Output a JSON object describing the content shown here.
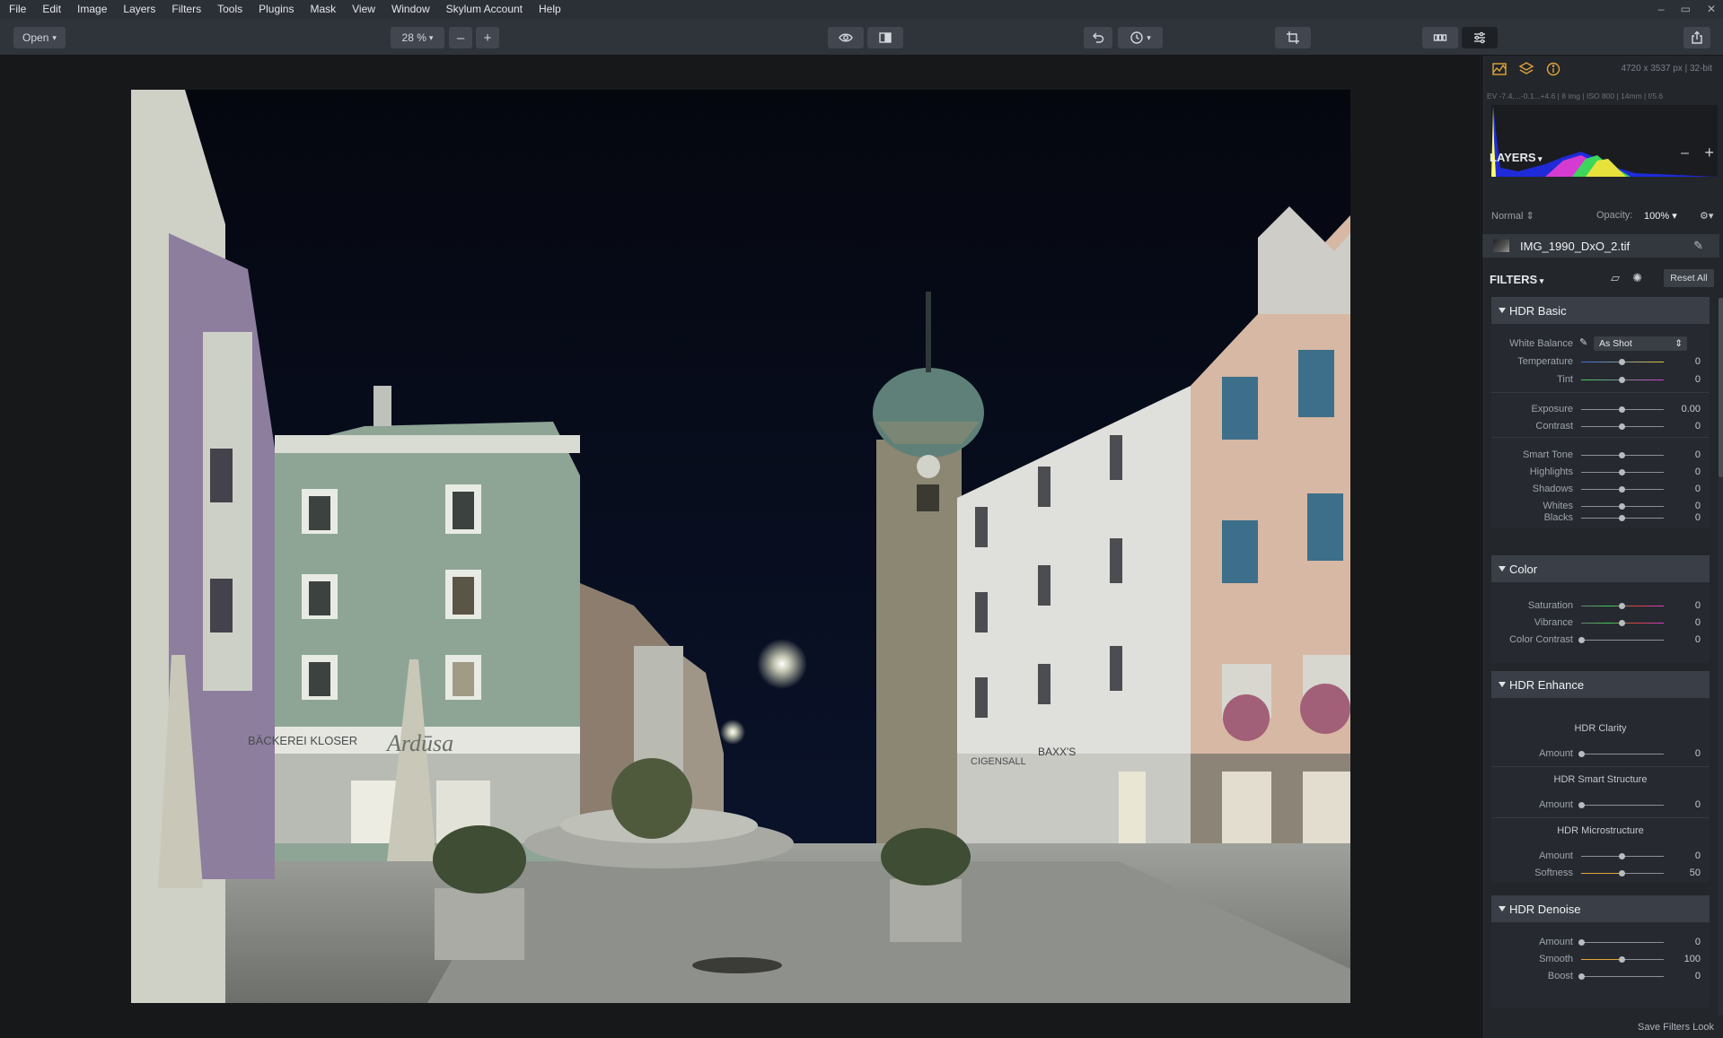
{
  "menu": [
    "File",
    "Edit",
    "Image",
    "Layers",
    "Filters",
    "Tools",
    "Plugins",
    "Mask",
    "View",
    "Window",
    "Skylum Account",
    "Help"
  ],
  "window_controls": [
    "–",
    "▭",
    "✕"
  ],
  "toolbar": {
    "open_label": "Open",
    "zoom_label": "28 %",
    "zoom_out": "–",
    "zoom_in": "+"
  },
  "panel": {
    "image_info": "4720 x 3537 px  |  32-bit",
    "exif": "EV -7.4,...-0.1...+4.6  |  8 img  |  ISO 800  |  14mm  |  f/5.6",
    "layers_title": "LAYERS",
    "blend_mode": "Normal",
    "opacity_label": "Opacity:",
    "opacity_value": "100%",
    "layer_name": "IMG_1990_DxO_2.tif",
    "filters_title": "FILTERS",
    "reset_all": "Reset All",
    "save_look": "Save Filters Look"
  },
  "filters": {
    "hdr_basic": {
      "title": "HDR Basic",
      "wb_label": "White Balance",
      "wb_value": "As Shot",
      "temperature": {
        "label": "Temperature",
        "value": "0"
      },
      "tint": {
        "label": "Tint",
        "value": "0"
      },
      "exposure": {
        "label": "Exposure",
        "value": "0.00"
      },
      "contrast": {
        "label": "Contrast",
        "value": "0"
      },
      "smart_tone": {
        "label": "Smart Tone",
        "value": "0"
      },
      "highlights": {
        "label": "Highlights",
        "value": "0"
      },
      "shadows": {
        "label": "Shadows",
        "value": "0"
      },
      "whites": {
        "label": "Whites",
        "value": "0"
      },
      "blacks": {
        "label": "Blacks",
        "value": "0"
      }
    },
    "color": {
      "title": "Color",
      "saturation": {
        "label": "Saturation",
        "value": "0"
      },
      "vibrance": {
        "label": "Vibrance",
        "value": "0"
      },
      "color_contrast": {
        "label": "Color Contrast",
        "value": "0"
      }
    },
    "hdr_enhance": {
      "title": "HDR Enhance",
      "clarity_title": "HDR Clarity",
      "clarity_amount": {
        "label": "Amount",
        "value": "0"
      },
      "structure_title": "HDR Smart Structure",
      "structure_amount": {
        "label": "Amount",
        "value": "0"
      },
      "micro_title": "HDR Microstructure",
      "micro_amount": {
        "label": "Amount",
        "value": "0"
      },
      "micro_softness": {
        "label": "Softness",
        "value": "50"
      }
    },
    "hdr_denoise": {
      "title": "HDR Denoise",
      "amount": {
        "label": "Amount",
        "value": "0"
      },
      "smooth": {
        "label": "Smooth",
        "value": "100"
      },
      "boost": {
        "label": "Boost",
        "value": "0"
      }
    }
  },
  "photo": {
    "shop_sign_left": "BÄCKEREI KLOSER",
    "shop_sign_center": "Ardūsa",
    "shop_sign_right_a": "CIGENSALL",
    "shop_sign_right_b": "BAXX'S"
  },
  "colors": {
    "accent": "#e0a53a",
    "panel_bg": "#23262b",
    "menubar_bg": "#2b2f36"
  }
}
